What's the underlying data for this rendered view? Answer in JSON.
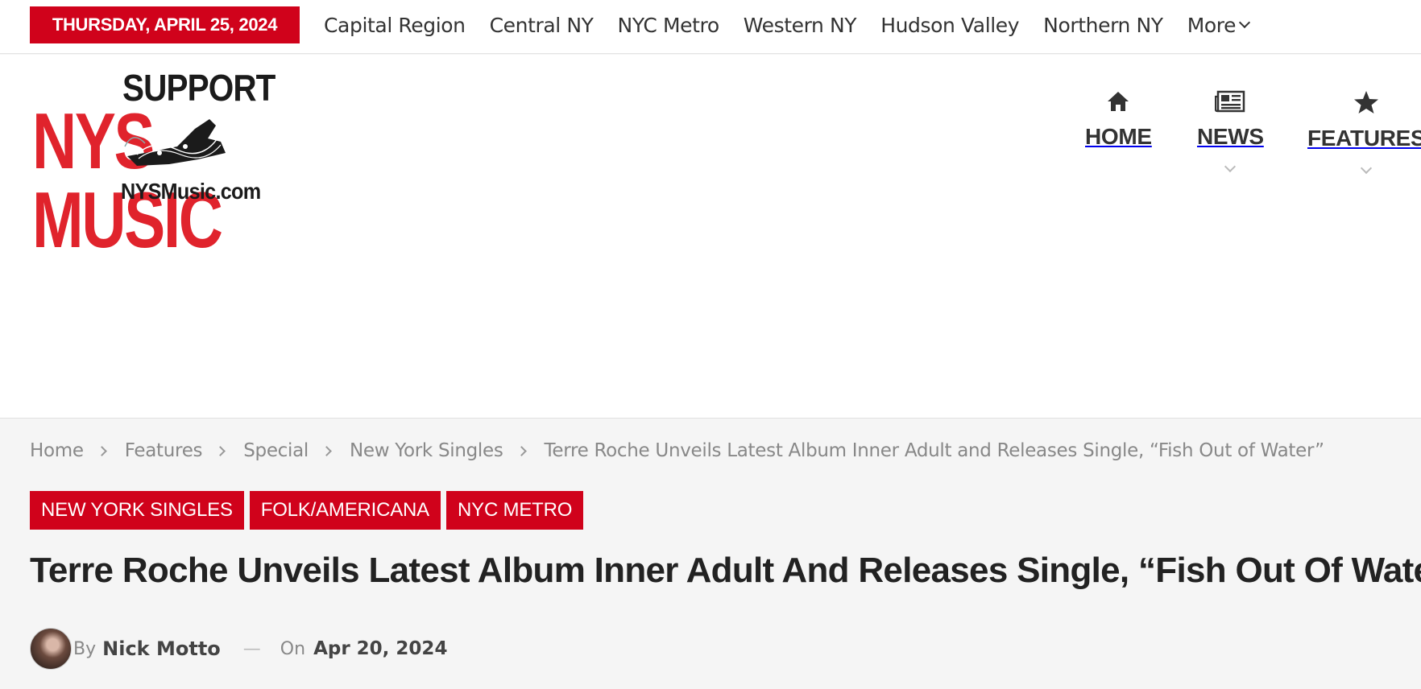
{
  "topbar": {
    "date": "THURSDAY, APRIL 25, 2024",
    "regions": [
      "Capital Region",
      "Central NY",
      "NYC Metro",
      "Western NY",
      "Hudson Valley",
      "Northern NY"
    ],
    "more_label": "More"
  },
  "logo": {
    "line1": "SUPPORT",
    "line2": "NYS MUSIC",
    "line3": "NYSMusic.com",
    "colors": {
      "red": "#e0232c",
      "dark": "#1b1b1b"
    }
  },
  "main_nav": {
    "items": [
      {
        "label": "HOME",
        "icon": "home-icon"
      },
      {
        "label": "NEWS",
        "icon": "newspaper-icon"
      },
      {
        "label": "FEATURES",
        "icon": "star-icon"
      }
    ]
  },
  "breadcrumb": [
    "Home",
    "Features",
    "Special",
    "New York Singles",
    "Terre Roche Unveils Latest Album Inner Adult and Releases Single, “Fish Out of Water”"
  ],
  "article": {
    "tags": [
      "NEW YORK SINGLES",
      "FOLK/AMERICANA",
      "NYC METRO"
    ],
    "title": "Terre Roche Unveils Latest Album Inner Adult And Releases Single, “Fish Out Of Water”",
    "by_label": "By",
    "author": "Nick Motto",
    "on_label": "On",
    "date": "Apr 20, 2024"
  },
  "accent_color": "#d0021b"
}
